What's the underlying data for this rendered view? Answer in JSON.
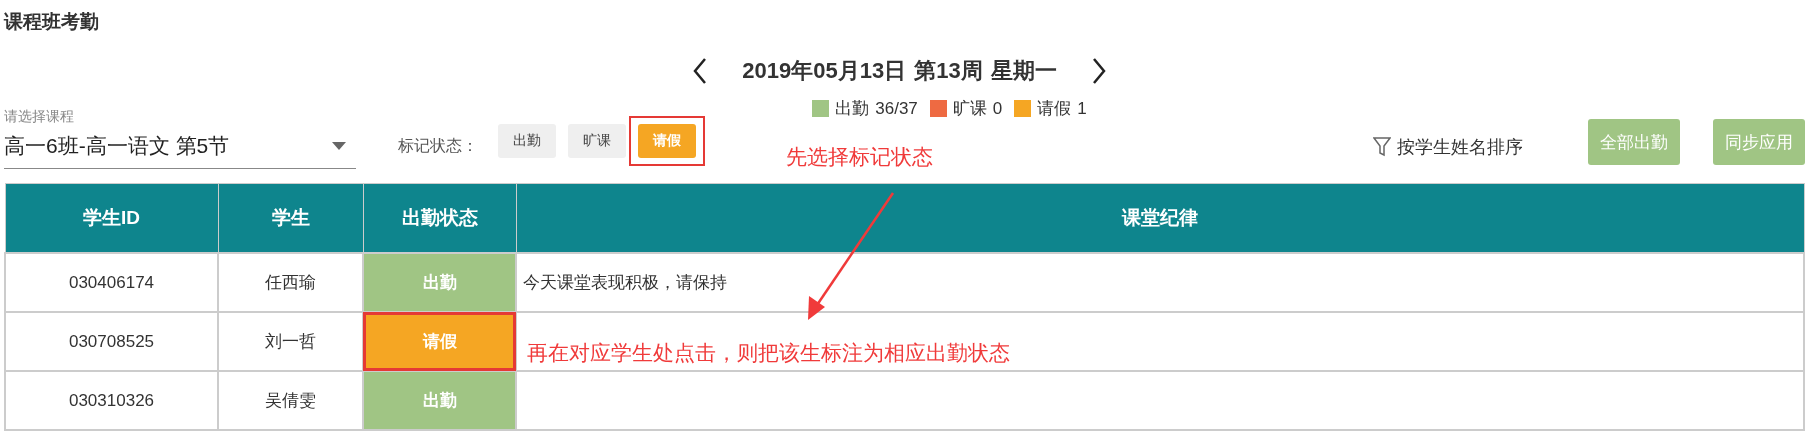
{
  "page_title": "课程班考勤",
  "date_nav": {
    "date": "2019年05月13日",
    "week": "第13周",
    "weekday": "星期一"
  },
  "legend": [
    {
      "label": "出勤",
      "count": "36/37",
      "color": "#a0c584"
    },
    {
      "label": "旷课",
      "count": "0",
      "color": "#ee6a42"
    },
    {
      "label": "请假",
      "count": "1",
      "color": "#f5a623"
    }
  ],
  "course_select": {
    "label": "请选择课程",
    "value": "高一6班-高一语文 第5节"
  },
  "mark_status": {
    "label": "标记状态：",
    "options": [
      {
        "label": "出勤",
        "selected": false,
        "highlighted": false
      },
      {
        "label": "旷课",
        "selected": false,
        "highlighted": false
      },
      {
        "label": "请假",
        "selected": true,
        "highlighted": true
      }
    ]
  },
  "sort": {
    "label": "按学生姓名排序"
  },
  "buttons": [
    "全部出勤",
    "同步应用"
  ],
  "table": {
    "columns": [
      "学生ID",
      "学生",
      "出勤状态",
      "课堂纪律"
    ],
    "rows": [
      {
        "student_id": "030406174",
        "student": "任西瑜",
        "status": {
          "label": "出勤",
          "kind": "present",
          "highlighted": false
        },
        "discipline": "今天课堂表现积极，请保持"
      },
      {
        "student_id": "030708525",
        "student": "刘一哲",
        "status": {
          "label": "请假",
          "kind": "leave",
          "highlighted": true
        }
      },
      {
        "student_id": "030310326",
        "student": "吴倩雯",
        "status": {
          "label": "出勤",
          "kind": "present",
          "highlighted": false
        }
      }
    ]
  },
  "annotations": [
    {
      "kind": "text",
      "text": "先选择标记状态"
    },
    {
      "kind": "arrow"
    },
    {
      "kind": "text",
      "text": "再在对应学生处点击，则把该生标注为相应出勤状态"
    }
  ]
}
